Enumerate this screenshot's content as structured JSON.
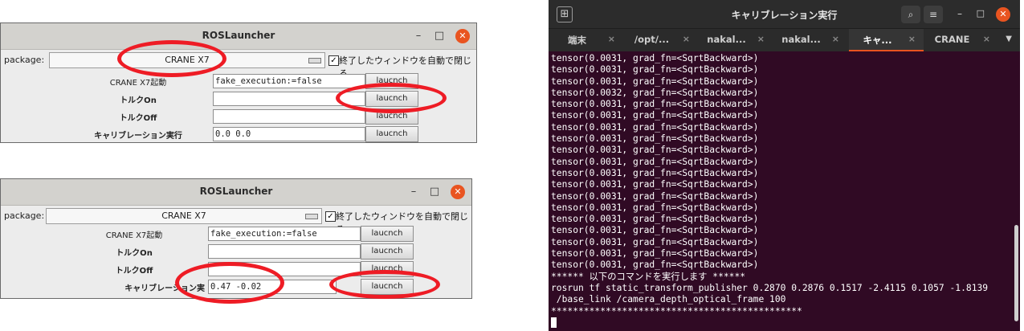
{
  "ros_window_1": {
    "title": "ROSLauncher",
    "min": "–",
    "max": "□",
    "close": "✕",
    "package_label": "package:",
    "package_value": "CRANE X7",
    "autoclose_check": "✓",
    "autoclose_label": "終了したウィンドウを自動で閉じる",
    "rows": [
      {
        "label": "CRANE X7起動",
        "value": "fake_execution:=false",
        "button": "laucnch"
      },
      {
        "label": "トルクOn",
        "value": "",
        "button": "laucnch"
      },
      {
        "label": "トルクOff",
        "value": "",
        "button": "laucnch"
      },
      {
        "label": "キャリブレーション実行",
        "value": "0.0 0.0",
        "button": "laucnch"
      }
    ]
  },
  "ros_window_2": {
    "title": "ROSLauncher",
    "min": "–",
    "max": "□",
    "close": "✕",
    "package_label": "package:",
    "package_value": "CRANE X7",
    "autoclose_check": "✓",
    "autoclose_label": "終了したウィンドウを自動で閉じる",
    "rows": [
      {
        "label": "CRANE X7起動",
        "value": "fake_execution:=false",
        "button": "laucnch"
      },
      {
        "label": "トルクOn",
        "value": "",
        "button": "laucnch"
      },
      {
        "label": "トルクOff",
        "value": "",
        "button": "laucnch"
      },
      {
        "label": "キャリブレーション実",
        "value": "0.47 -0.02",
        "button": "laucnch"
      }
    ]
  },
  "terminal": {
    "title": "キャリブレーション実行",
    "new_tab_icon": "⊞",
    "search_icon": "⌕",
    "menu_icon": "≡",
    "min": "–",
    "max": "□",
    "close": "✕",
    "tabs": [
      {
        "label": "端末",
        "close": "×"
      },
      {
        "label": "/opt/...",
        "close": "×"
      },
      {
        "label": "nakal...",
        "close": "×"
      },
      {
        "label": "nakal...",
        "close": "×"
      },
      {
        "label": "キャ...",
        "close": "×"
      },
      {
        "label": "CRANE",
        "close": "×"
      }
    ],
    "tab_menu": "▼",
    "lines": [
      "tensor(0.0031, grad_fn=<SqrtBackward>)",
      "tensor(0.0031, grad_fn=<SqrtBackward>)",
      "tensor(0.0031, grad_fn=<SqrtBackward>)",
      "tensor(0.0032, grad_fn=<SqrtBackward>)",
      "tensor(0.0031, grad_fn=<SqrtBackward>)",
      "tensor(0.0031, grad_fn=<SqrtBackward>)",
      "tensor(0.0031, grad_fn=<SqrtBackward>)",
      "tensor(0.0031, grad_fn=<SqrtBackward>)",
      "tensor(0.0031, grad_fn=<SqrtBackward>)",
      "tensor(0.0031, grad_fn=<SqrtBackward>)",
      "tensor(0.0031, grad_fn=<SqrtBackward>)",
      "tensor(0.0031, grad_fn=<SqrtBackward>)",
      "tensor(0.0031, grad_fn=<SqrtBackward>)",
      "tensor(0.0031, grad_fn=<SqrtBackward>)",
      "tensor(0.0031, grad_fn=<SqrtBackward>)",
      "tensor(0.0031, grad_fn=<SqrtBackward>)",
      "tensor(0.0031, grad_fn=<SqrtBackward>)",
      "tensor(0.0031, grad_fn=<SqrtBackward>)",
      "tensor(0.0031, grad_fn=<SqrtBackward>)",
      "****** 以下のコマンドを実行します ******",
      "rosrun tf static_transform_publisher 0.2870 0.2876 0.1517 -2.4115 0.1057 -1.8139",
      " /base_link /camera_depth_optical_frame 100",
      "**********************************************"
    ]
  }
}
